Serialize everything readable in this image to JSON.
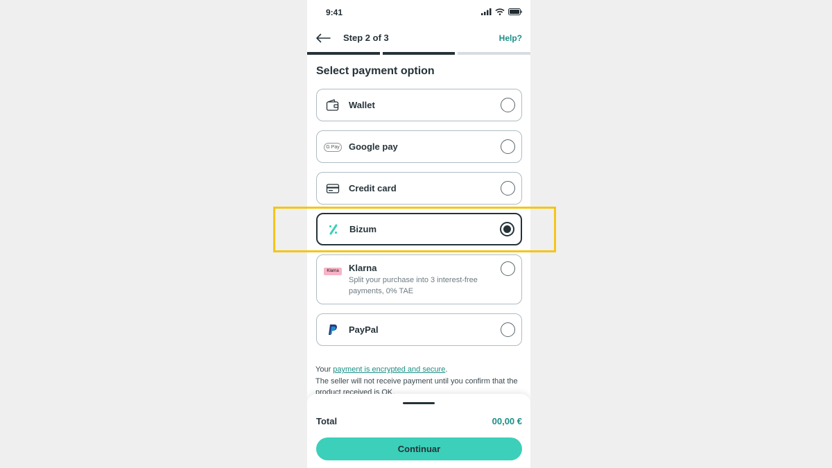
{
  "status_bar": {
    "time": "9:41"
  },
  "header": {
    "step": "Step 2 of 3",
    "help": "Help?"
  },
  "progress": {
    "current_step": 2,
    "total_steps": 3
  },
  "section_title": "Select payment option",
  "options": [
    {
      "label": "Wallet",
      "icon": "wallet-icon",
      "selected": false
    },
    {
      "label": "Google pay",
      "icon": "google-pay-icon",
      "icon_text": "G Pay",
      "selected": false
    },
    {
      "label": "Credit card",
      "icon": "credit-card-icon",
      "selected": false
    },
    {
      "label": "Bizum",
      "icon": "bizum-icon",
      "selected": true
    },
    {
      "label": "Klarna",
      "icon": "klarna-icon",
      "icon_text": "Klarna",
      "description": "Split your purchase into 3 interest-free payments, 0% TAE",
      "selected": false
    },
    {
      "label": "PayPal",
      "icon": "paypal-icon",
      "selected": false
    }
  ],
  "note": {
    "prefix": "Your ",
    "link": "payment is encrypted and secure",
    "suffix": ".",
    "line2": "The seller will not receive payment until you confirm that the product received is OK."
  },
  "footer": {
    "total_label": "Total",
    "total_value": "00,00 €",
    "button": "Continuar"
  },
  "colors": {
    "accent": "#3ccfba",
    "link": "#1a8f86",
    "text": "#253238",
    "highlight": "#f5c518"
  }
}
